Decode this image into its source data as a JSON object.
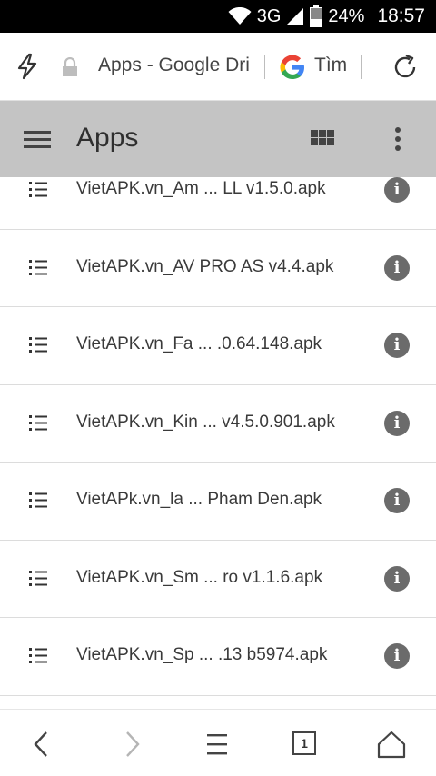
{
  "status_bar": {
    "network": "3G",
    "battery": "24%",
    "time": "18:57"
  },
  "browser": {
    "url_text": "Apps - Google Dri",
    "search_label": "Tìm",
    "tab_count": "1"
  },
  "header": {
    "title": "Apps"
  },
  "files": [
    {
      "name": "VietAPK.vn_Am ... LL v1.5.0.apk"
    },
    {
      "name": "VietAPK.vn_AV PRO AS v4.4.apk"
    },
    {
      "name": "VietAPK.vn_Fa ... .0.64.148.apk"
    },
    {
      "name": "VietAPK.vn_Kin ... v4.5.0.901.apk"
    },
    {
      "name": "VietAPk.vn_la ... Pham Den.apk"
    },
    {
      "name": "VietAPK.vn_Sm ... ro v1.1.6.apk"
    },
    {
      "name": "VietAPK.vn_Sp ... .13 b5974.apk"
    },
    {
      "name": ""
    }
  ],
  "icons": {
    "info": "i"
  },
  "colors": {
    "header_bg": "#c4c4c4",
    "status_bg": "#000000",
    "info_icon": "#6b6b6b"
  }
}
